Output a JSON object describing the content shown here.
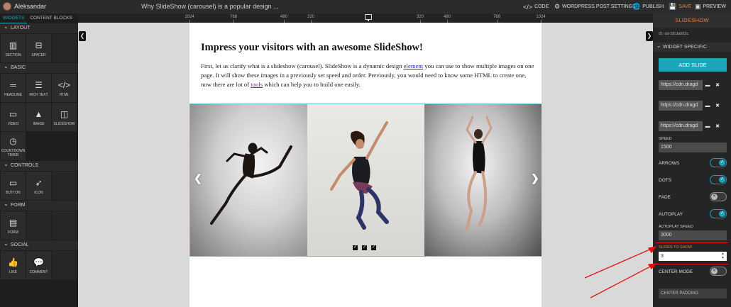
{
  "topbar": {
    "user_name": "Aleksandar",
    "doc_title": "Why SlideShow (carousel) is a popular design ...",
    "code_label": "CODE",
    "wp_settings_label": "WORDPRESS POST SETTINGS",
    "publish_label": "PUBLISH",
    "save_label": "SAVE",
    "preview_label": "PREVIEW"
  },
  "ruler": {
    "ticks": [
      "1024",
      "768",
      "480",
      "320",
      "320",
      "480",
      "768",
      "1024"
    ]
  },
  "left_panel": {
    "tabs": [
      "WIDGETS",
      "CONTENT BLOCKS"
    ],
    "sections": [
      {
        "title": "LAYOUT",
        "items": [
          {
            "label": "SECTION",
            "icon": "section-icon"
          },
          {
            "label": "SPACER",
            "icon": "spacer-icon"
          }
        ]
      },
      {
        "title": "BASIC",
        "items": [
          {
            "label": "HEADLINE",
            "icon": "headline-icon"
          },
          {
            "label": "RICH TEXT",
            "icon": "rich-text-icon"
          },
          {
            "label": "HTML",
            "icon": "html-icon"
          },
          {
            "label": "VIDEO",
            "icon": "video-icon"
          },
          {
            "label": "IMAGE",
            "icon": "image-icon"
          },
          {
            "label": "SLIDESHOW",
            "icon": "slideshow-icon"
          },
          {
            "label": "COUNTDOWN TIMER",
            "icon": "countdown-timer-icon"
          }
        ]
      },
      {
        "title": "CONTROLS",
        "items": [
          {
            "label": "BUTTON",
            "icon": "button-icon"
          },
          {
            "label": "ICON",
            "icon": "rocket-icon"
          }
        ]
      },
      {
        "title": "FORM",
        "items": [
          {
            "label": "FORM",
            "icon": "form-icon"
          }
        ]
      },
      {
        "title": "SOCIAL",
        "items": [
          {
            "label": "LIKE",
            "icon": "like-icon"
          },
          {
            "label": "COMMENT",
            "icon": "comment-icon"
          }
        ]
      }
    ]
  },
  "canvas": {
    "heading": "Impress your visitors with an awesome SlideShow!",
    "para_1": "First, let us clarify what is a slideshow (carousel). SlideShow is a dynamic design ",
    "para_link_1": "element",
    "para_2": " you can use to show multiple images on one page.  It will show these images in a previously set speed and order. Previously, you would need to know some HTML to create one, now there are lot of ",
    "para_link_2": "tools",
    "para_3": " which can help you to build one easily."
  },
  "right_panel": {
    "title": "SLIDESHOW",
    "id_text": "ID: dd-581fa063c",
    "section_title": "WIDGET SPECIFIC",
    "add_slide_label": "ADD SLIDE",
    "slide_urls": [
      "https://cdn.dragd",
      "https://cdn.dragd",
      "https://cdn.dragd"
    ],
    "speed_label": "SPEED",
    "speed_value": "1500",
    "arrows_label": "ARROWS",
    "arrows_on": true,
    "dots_label": "DOTS",
    "dots_on": true,
    "fade_label": "FADE",
    "fade_on": false,
    "autoplay_label": "AUTOPLAY",
    "autoplay_on": true,
    "autoplay_speed_label": "AUTOPLAY SPEED",
    "autoplay_speed_value": "3000",
    "slides_to_show_label": "SLIDES TO SHOW",
    "slides_to_show_value": "3",
    "center_mode_label": "CENTER MODE",
    "center_mode_on": false,
    "center_padding_label": "CENTER PADDING"
  },
  "colors": {
    "accent": "#1aa5bb",
    "title_orange": "#e08050",
    "annotation_red": "#e11111"
  }
}
